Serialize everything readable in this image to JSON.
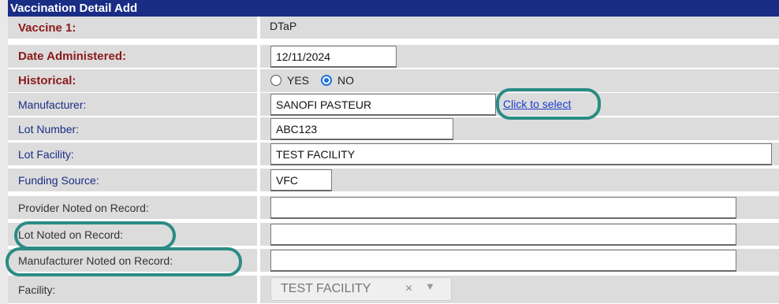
{
  "header": {
    "title": "Vaccination Detail Add"
  },
  "rows": [
    {
      "label": "Vaccine 1:",
      "value": "DTaP"
    },
    {
      "label": "Date Administered:",
      "value": "12/11/2024"
    },
    {
      "label": "Historical:",
      "options": [
        "YES",
        "NO"
      ],
      "selected": "NO"
    },
    {
      "label": "Manufacturer:",
      "value": "SANOFI PASTEUR",
      "link": "Click to select"
    },
    {
      "label": "Lot Number:",
      "value": "ABC123"
    },
    {
      "label": "Lot Facility:",
      "value": "TEST FACILITY"
    },
    {
      "label": "Funding Source:",
      "value": "VFC"
    },
    {
      "label": "Provider Noted on Record:",
      "value": ""
    },
    {
      "label": "Lot Noted on Record:",
      "value": ""
    },
    {
      "label": "Manufacturer Noted on Record:",
      "value": ""
    },
    {
      "label": "Facility:",
      "value": "TEST FACILITY",
      "clear": "×",
      "arrow": "▼"
    }
  ],
  "colors": {
    "header": "#1a2d85",
    "required": "#8b1a1a",
    "highlight": "#2b8c84"
  }
}
